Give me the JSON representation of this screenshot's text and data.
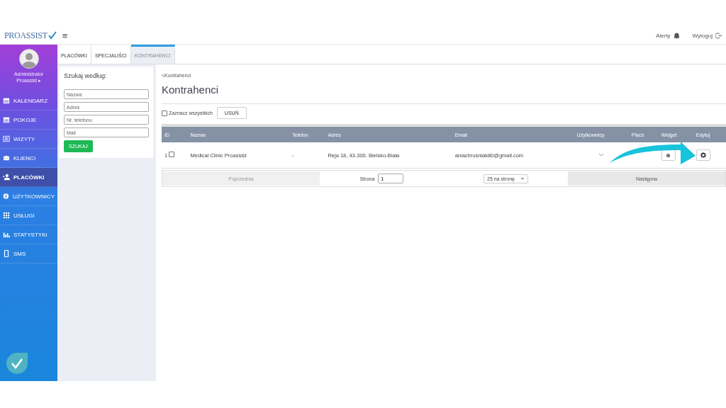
{
  "header": {
    "logo": "PROASSIST",
    "menu_icon": "≡",
    "alerts": "Alerty",
    "logout": "Wyloguj"
  },
  "user": {
    "name": "Administrator",
    "account": "Proassist ▸"
  },
  "sidebar": {
    "items": [
      {
        "label": "KALENDARZ",
        "selected": false
      },
      {
        "label": "POKOJE",
        "selected": false
      },
      {
        "label": "WIZYTY",
        "selected": false
      },
      {
        "label": "KLIENCI",
        "selected": false
      },
      {
        "label": "PLACÓWKI",
        "selected": true
      },
      {
        "label": "UŻYTKOWNICY",
        "selected": false
      },
      {
        "label": "USŁUGI",
        "selected": false
      },
      {
        "label": "STATYSTYKI",
        "selected": false
      },
      {
        "label": "SMS",
        "selected": false
      }
    ]
  },
  "tabs": [
    {
      "label": "PLACÓWKI",
      "selected": false
    },
    {
      "label": "SPECJALIŚCI",
      "selected": false
    },
    {
      "label": "KONTRAHENCI",
      "selected": true
    }
  ],
  "search": {
    "title": "Szukaj według:",
    "fields": [
      {
        "placeholder": "Nazwa"
      },
      {
        "placeholder": "Adres"
      },
      {
        "placeholder": "Nr. telefonu"
      },
      {
        "placeholder": "Mail"
      }
    ],
    "button": "SZUKAJ"
  },
  "breadcrumb": "<Kontrahenci",
  "page_title": "Kontrahenci",
  "select_all": {
    "label": "Zaznacz wszystkich",
    "checked": false
  },
  "delete_button": "USUŃ",
  "table": {
    "columns": [
      "ID",
      "Nazwa",
      "Telefon",
      "Adres",
      "Email",
      "Użytkownicy",
      "Placó",
      "Widget",
      "Edytuj"
    ],
    "rows": [
      {
        "id": "1",
        "checked": false,
        "name": "Medical Clinic Proassist",
        "phone": "-",
        "address": "Reja 18, 43-300, Bielsko-Biała",
        "email": "aniachrusniak80@gmail.com"
      }
    ]
  },
  "pagination": {
    "previous": "Poprzednia",
    "page_label": "Strona",
    "page": "1",
    "per_page": "25 na stronę",
    "next": "Następna"
  }
}
